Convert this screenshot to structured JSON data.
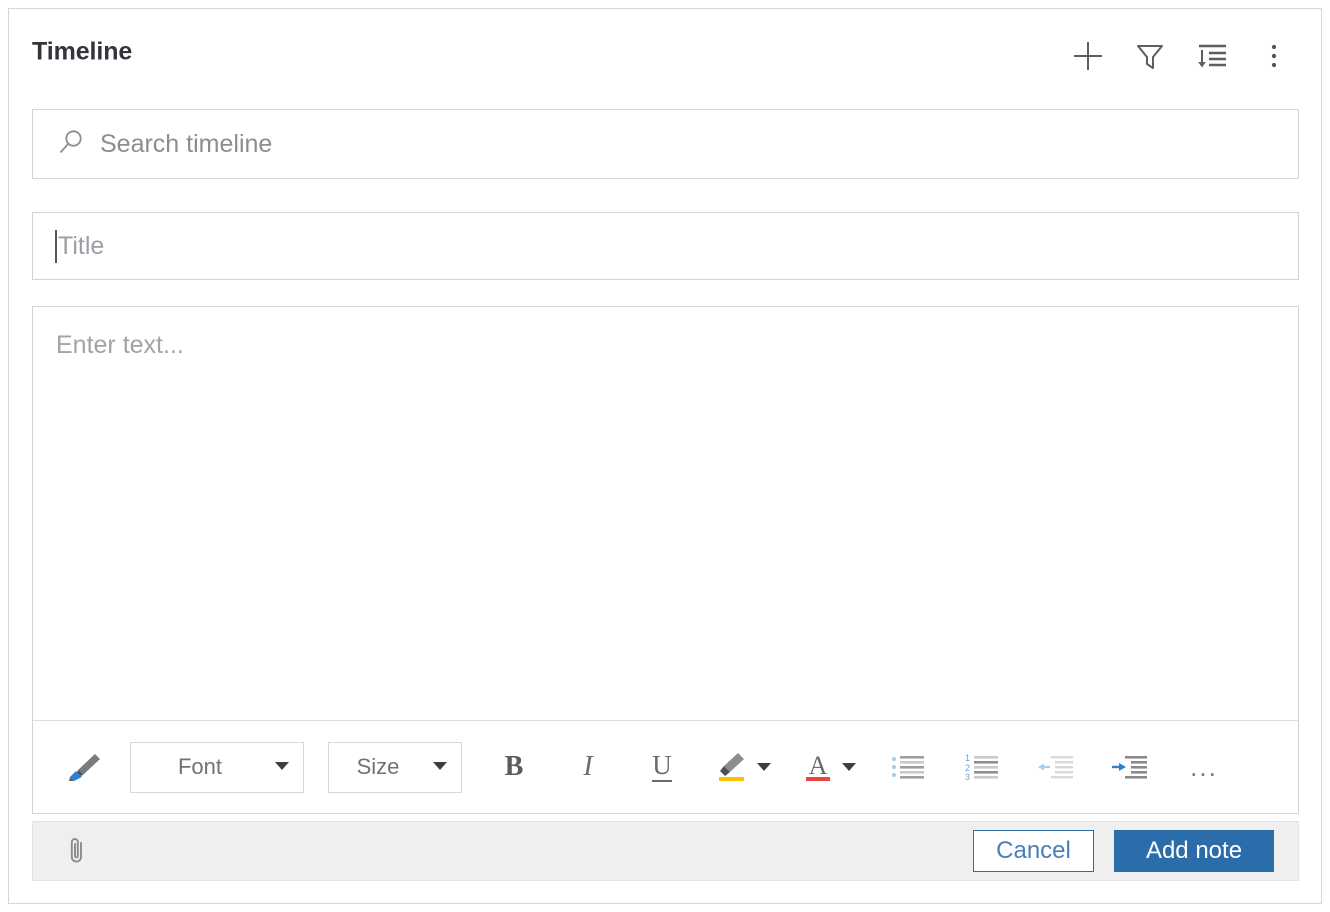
{
  "panel": {
    "title": "Timeline",
    "accent_color": "#2b6cab",
    "border_color": "#d3d3d3",
    "footer_bg": "#efefef"
  },
  "header": {
    "title": "Timeline",
    "actions": [
      {
        "name": "add-icon",
        "label": "Add"
      },
      {
        "name": "filter-icon",
        "label": "Filter"
      },
      {
        "name": "sort-icon",
        "label": "Sort"
      },
      {
        "name": "more-options-icon",
        "label": "More options"
      }
    ]
  },
  "search": {
    "icon": "search-icon",
    "placeholder": "Search timeline",
    "value": ""
  },
  "note_form": {
    "title_field": {
      "placeholder": "Title",
      "value": "",
      "focused": true
    },
    "body_field": {
      "placeholder": "Enter text...",
      "value": ""
    },
    "toolbar": {
      "format_painter": {
        "name": "format-painter-icon",
        "label": "Format painter"
      },
      "font": {
        "label": "Font",
        "caret": "chevron-down-icon"
      },
      "size": {
        "label": "Size",
        "caret": "chevron-down-icon"
      },
      "bold": {
        "name": "bold-icon",
        "label": "B"
      },
      "italic": {
        "name": "italic-icon",
        "label": "I"
      },
      "underline": {
        "name": "underline-icon",
        "label": "U"
      },
      "highlight": {
        "name": "highlight-color-icon",
        "label": "Text highlight color",
        "color": "#ffc000"
      },
      "font_color": {
        "name": "font-color-icon",
        "label": "A",
        "color": "#e8453c"
      },
      "bulleted_list": {
        "name": "bulleted-list-icon",
        "label": "Bulleted list"
      },
      "numbered_list": {
        "name": "numbered-list-icon",
        "label": "Numbered list"
      },
      "decrease_indent": {
        "name": "decrease-indent-icon",
        "label": "Decrease indent",
        "disabled": true
      },
      "increase_indent": {
        "name": "increase-indent-icon",
        "label": "Increase indent",
        "disabled": false
      },
      "overflow": {
        "name": "toolbar-overflow-icon",
        "label": "..."
      }
    }
  },
  "footer": {
    "attach": {
      "name": "attachment-icon",
      "label": "Attach"
    },
    "cancel_label": "Cancel",
    "add_note_label": "Add note"
  }
}
